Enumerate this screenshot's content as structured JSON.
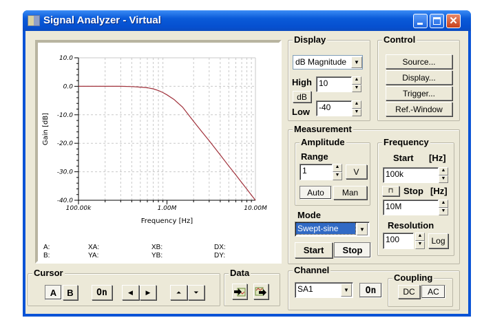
{
  "window": {
    "title": "Signal Analyzer - Virtual"
  },
  "chart_data": {
    "type": "line",
    "xlabel": "Frequency [Hz]",
    "ylabel": "Gain [dB]",
    "xscale": "log",
    "xlim": [
      100000,
      10000000
    ],
    "ylim": [
      -40,
      10
    ],
    "xticks": [
      "100.00k",
      "1.00M",
      "10.00M"
    ],
    "yticks": [
      "10.0",
      "0.0",
      "-10.0",
      "-20.0",
      "-30.0",
      "-40.0"
    ],
    "grid": true,
    "line_color": "#a0303a",
    "series": [
      {
        "name": "Gain",
        "x": [
          100000,
          200000,
          300000,
          400000,
          500000,
          600000,
          700000,
          800000,
          900000,
          1000000,
          1200000,
          1500000,
          2000000,
          2500000,
          3000000,
          4000000,
          5000000,
          6000000,
          7000000,
          8000000,
          9000000,
          10000000
        ],
        "y": [
          0,
          0,
          0,
          -0.1,
          -0.3,
          -0.5,
          -0.9,
          -1.5,
          -2.2,
          -3.0,
          -4.6,
          -7.3,
          -12.3,
          -16.1,
          -19.1,
          -24.1,
          -28.0,
          -31.1,
          -33.8,
          -36.1,
          -38.2,
          -40.0
        ]
      }
    ]
  },
  "cursor_info": {
    "a": "A:",
    "b": "B:",
    "xa": "XA:",
    "ya": "YA:",
    "xb": "XB:",
    "yb": "YB:",
    "dx": "DX:",
    "dy": "DY:"
  },
  "display": {
    "label": "Display",
    "mode": "dB Magnitude",
    "high_label": "High",
    "high": "10",
    "unit": "dB",
    "low_label": "Low",
    "low": "-40"
  },
  "control": {
    "label": "Control",
    "buttons": [
      "Source...",
      "Display...",
      "Trigger...",
      "Ref.-Window"
    ]
  },
  "measurement": {
    "label": "Measurement",
    "amplitude": {
      "label": "Amplitude",
      "range_label": "Range",
      "range": "1",
      "unit": "V",
      "auto": "Auto",
      "man": "Man"
    },
    "mode_label": "Mode",
    "mode": "Swept-sine",
    "start": "Start",
    "stop": "Stop",
    "frequency": {
      "label": "Frequency",
      "start_label": "Start",
      "start_unit": "[Hz]",
      "start": "100k",
      "stop_label": "Stop",
      "stop_unit": "[Hz]",
      "stop": "10M",
      "resolution_label": "Resolution",
      "resolution": "100",
      "log": "Log"
    }
  },
  "channel": {
    "label": "Channel",
    "value": "SA1",
    "on": "On",
    "coupling_label": "Coupling",
    "dc": "DC",
    "ac": "AC"
  },
  "cursor": {
    "label": "Cursor",
    "a": "A",
    "b": "B",
    "on": "On"
  },
  "data": {
    "label": "Data"
  }
}
